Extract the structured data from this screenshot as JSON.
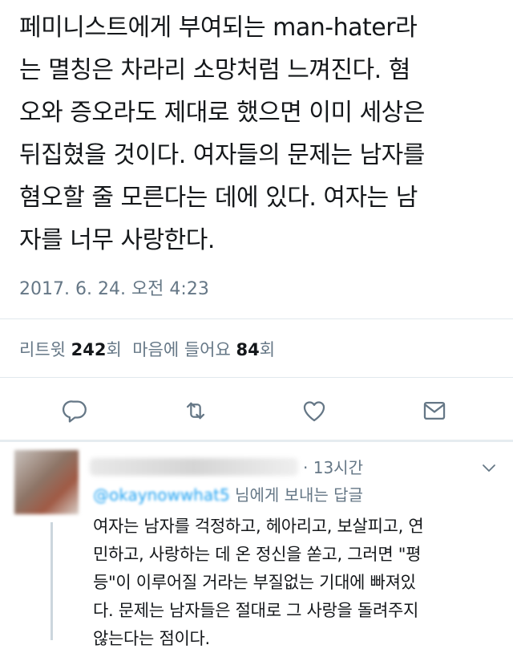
{
  "tweet": {
    "text": "페미니스트에게 부여되는 man-hater라\n는 멸칭은 차라리 소망처럼 느껴진다. 혐\n오와 증오라도 제대로 했으면 이미 세상은\n뒤집혔을 것이다. 여자들의 문제는 남자를\n혐오할 줄 모른다는 데에 있다. 여자는 남\n자를 너무 사랑한다.",
    "timestamp": "2017. 6. 24. 오전 4:23"
  },
  "stats": {
    "retweets_label": "리트윗",
    "retweets_count": "242",
    "retweets_unit": "회",
    "likes_label": "마음에 들어요",
    "likes_count": "84",
    "likes_unit": "회"
  },
  "actions": {
    "icons": [
      "reply-icon",
      "retweet-icon",
      "like-icon",
      "direct-message-icon"
    ],
    "color": "#657786"
  },
  "reply": {
    "time_ago": "· 13시간",
    "reply_to_handle": "@okaynowwhat5",
    "reply_to_suffix": " 님에게 보내는 답글",
    "text": "여자는 남자를 걱정하고, 헤아리고, 보살피고, 연\n민하고, 사랑하는 데 온 정신을 쏟고, 그러면 \"평\n등\"이 이루어질 거라는 부질없는 기대에 빠져있\n다. 문제는 남자들은 절대로 그 사랑을 돌려주지\n않는다는 점이다."
  },
  "colors": {
    "text": "#14171a",
    "secondary": "#657786",
    "link": "#1da1f2",
    "divider": "#e1e8ed"
  }
}
